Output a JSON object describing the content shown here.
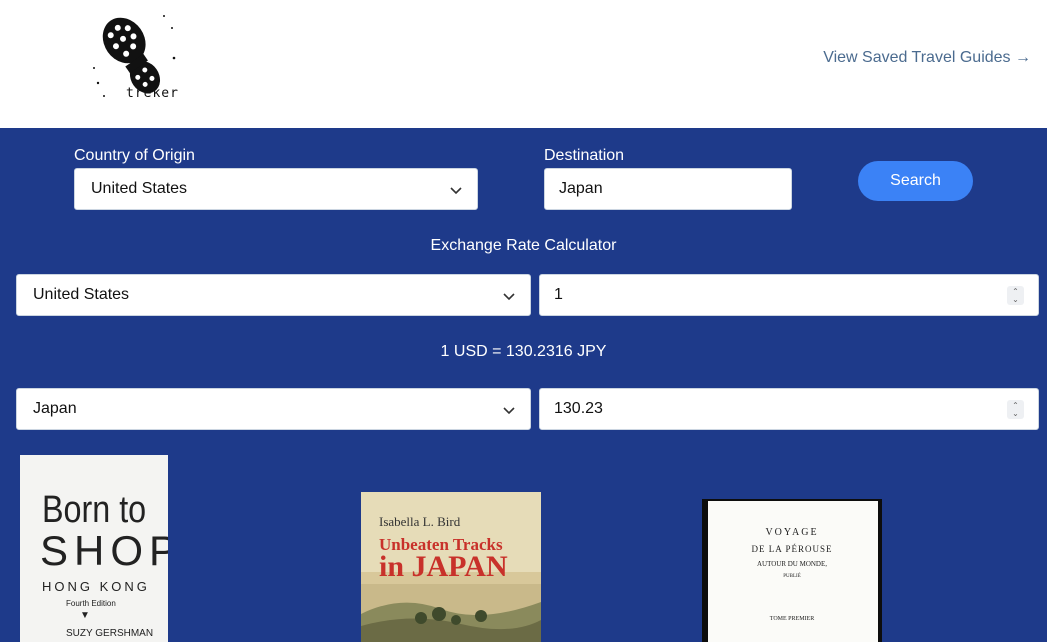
{
  "header": {
    "logo_text": "treker",
    "saved_link": "View Saved Travel Guides →"
  },
  "search_form": {
    "origin_label": "Country of Origin",
    "origin_value": "United States",
    "destination_label": "Destination",
    "destination_value": "Japan",
    "search_label": "Search"
  },
  "exchange": {
    "title": "Exchange Rate Calculator",
    "from_country": "United States",
    "from_amount": "1",
    "rate_text": "1 USD = 130.2316 JPY",
    "to_country": "Japan",
    "to_amount": "130.23"
  },
  "books": [
    {
      "title_line1": "Born to",
      "title_line2": "SHOP",
      "subtitle": "HONG KONG",
      "edition": "Fourth Edition",
      "author": "SUZY GERSHMAN"
    },
    {
      "author": "Isabella L. Bird",
      "title_line1": "Unbeaten Tracks",
      "title_line2": "in JAPAN"
    },
    {
      "line1": "VOYAGE",
      "line2": "DE LA PÉROUSE",
      "line3": "AUTOUR DU MONDE,",
      "line4": "PUBLIÉ",
      "line5": "TOME PREMIER"
    }
  ],
  "colors": {
    "background": "#1e3a8a",
    "accent": "#3b82f6",
    "link": "#4b6b8f"
  },
  "icons": [
    "boot-print-logo-icon",
    "chevron-down-icon",
    "spinner-icon"
  ]
}
